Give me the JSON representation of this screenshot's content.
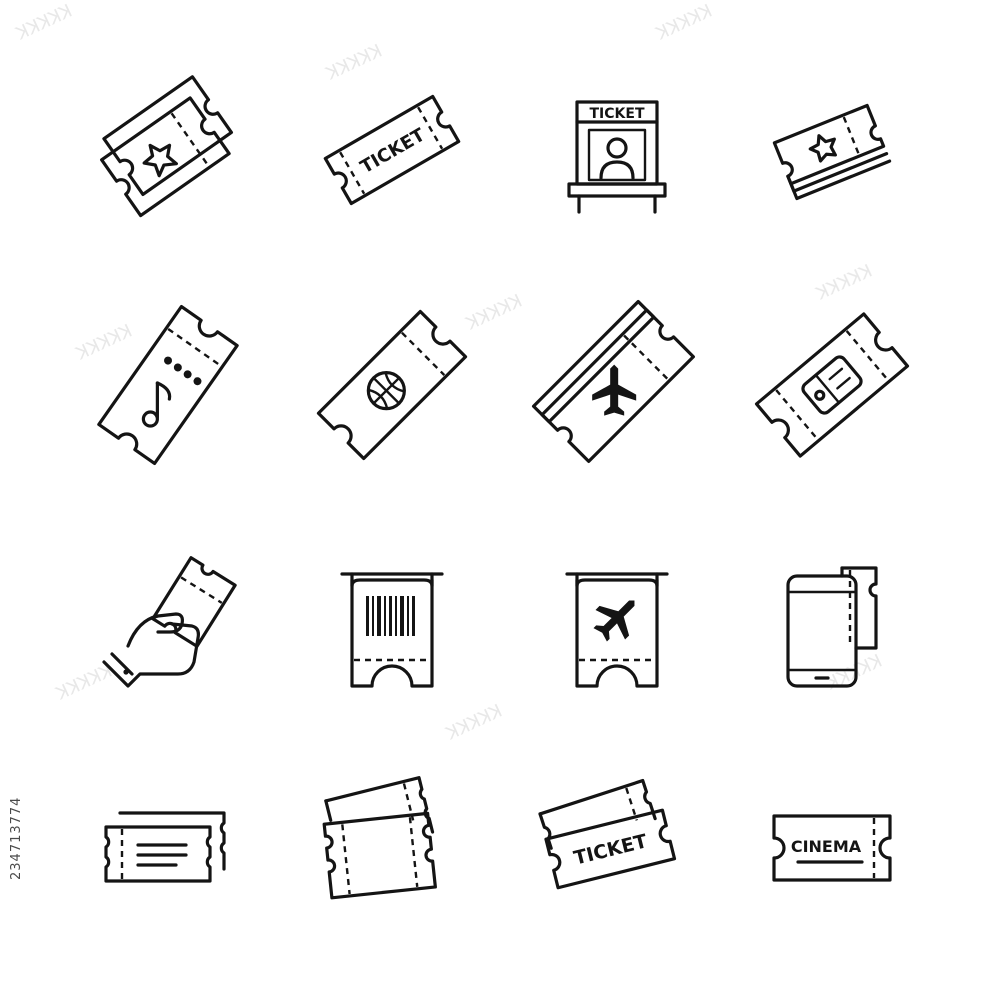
{
  "icon_set": {
    "rows": [
      [
        {
          "name": "star-ticket-pair-icon"
        },
        {
          "name": "ticket-label-icon",
          "label": "TICKET"
        },
        {
          "name": "ticket-booth-icon",
          "label": "TICKET"
        },
        {
          "name": "star-ticket-stack-icon"
        }
      ],
      [
        {
          "name": "music-ticket-icon"
        },
        {
          "name": "basketball-ticket-icon"
        },
        {
          "name": "flight-ticket-pair-icon"
        },
        {
          "name": "game-ticket-icon"
        }
      ],
      [
        {
          "name": "hand-holding-ticket-icon"
        },
        {
          "name": "barcode-ticket-dispenser-icon"
        },
        {
          "name": "flight-ticket-dispenser-icon"
        },
        {
          "name": "mobile-ticket-icon"
        }
      ],
      [
        {
          "name": "paired-tickets-icon"
        },
        {
          "name": "fanned-tickets-icon"
        },
        {
          "name": "ticket-pair-label-icon",
          "label": "TICKET"
        },
        {
          "name": "cinema-ticket-icon",
          "label": "CINEMA"
        }
      ]
    ]
  },
  "stock_id": "234713774",
  "colors": {
    "line": "#141414",
    "background": "#ffffff",
    "watermark": "#e6e6e6"
  }
}
